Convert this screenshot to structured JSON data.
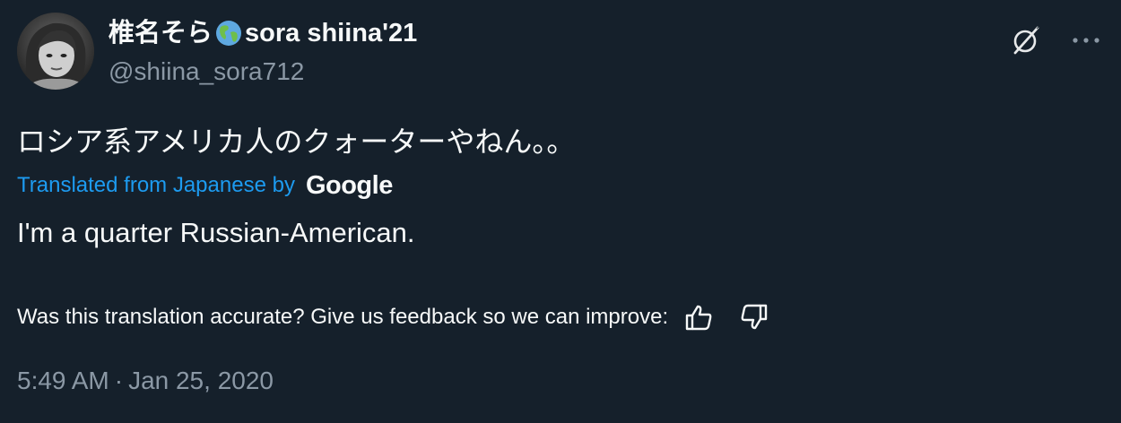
{
  "author": {
    "display_name_jp": "椎名そら",
    "flag_icon": "globe-americas-icon",
    "display_name_en": "sora shiina'21",
    "handle": "@shiina_sora712"
  },
  "tweet": {
    "text": "ロシア系アメリカ人のクォーターやねん。。"
  },
  "translation": {
    "label": "Translated from Japanese by",
    "provider": "Google",
    "text": "I'm a quarter Russian-American.",
    "feedback_prompt": "Was this translation accurate? Give us feedback so we can improve:"
  },
  "meta": {
    "time": "5:49 AM",
    "separator": "·",
    "date": "Jan 25, 2020"
  },
  "colors": {
    "background": "#15202b",
    "text_primary": "#f7f9f9",
    "text_secondary": "#8b98a5",
    "link": "#1d9bf0"
  }
}
